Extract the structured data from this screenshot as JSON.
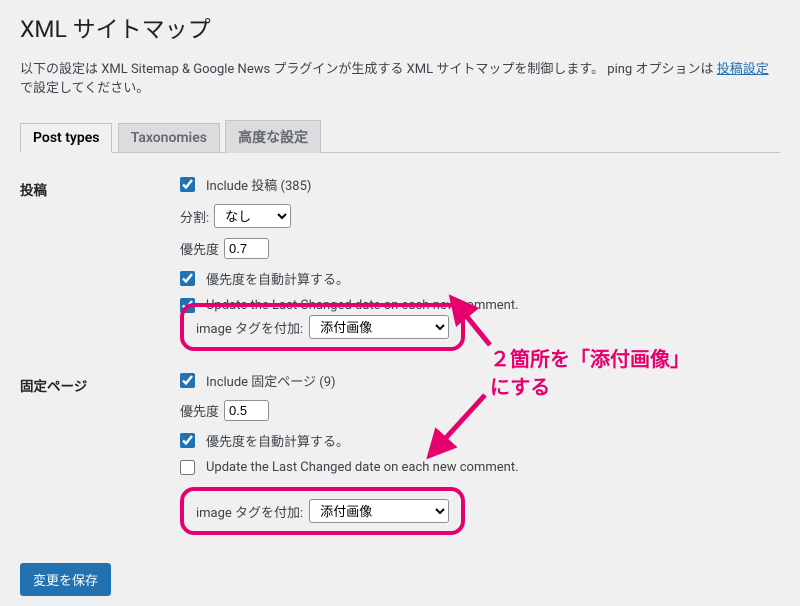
{
  "page": {
    "title": "XML サイトマップ",
    "description_1": "以下の設定は XML Sitemap & Google News プラグインが生成する XML サイトマップを制御します。 ping オプションは ",
    "description_link": "投稿設定",
    "description_2": " で設定してください。"
  },
  "tabs": {
    "post_types": "Post types",
    "taxonomies": "Taxonomies",
    "advanced": "高度な設定"
  },
  "sections": {
    "posts": {
      "heading": "投稿",
      "include_label": "Include 投稿 (385)",
      "split_label": "分割:",
      "split_value": "なし",
      "priority_label": "優先度",
      "priority_value": "0.7",
      "auto_priority_label": "優先度を自動計算する。",
      "update_last_label": "Update the Last Changed date on each new comment.",
      "image_tag_label": "image タグを付加:",
      "image_tag_value": "添付画像"
    },
    "pages": {
      "heading": "固定ページ",
      "include_label": "Include 固定ページ (9)",
      "priority_label": "優先度",
      "priority_value": "0.5",
      "auto_priority_label": "優先度を自動計算する。",
      "update_last_label": "Update the Last Changed date on each new comment.",
      "image_tag_label": "image タグを付加:",
      "image_tag_value": "添付画像"
    }
  },
  "buttons": {
    "save": "変更を保存"
  },
  "annotation": {
    "line1": "２箇所を「添付画像」",
    "line2": "にする"
  }
}
